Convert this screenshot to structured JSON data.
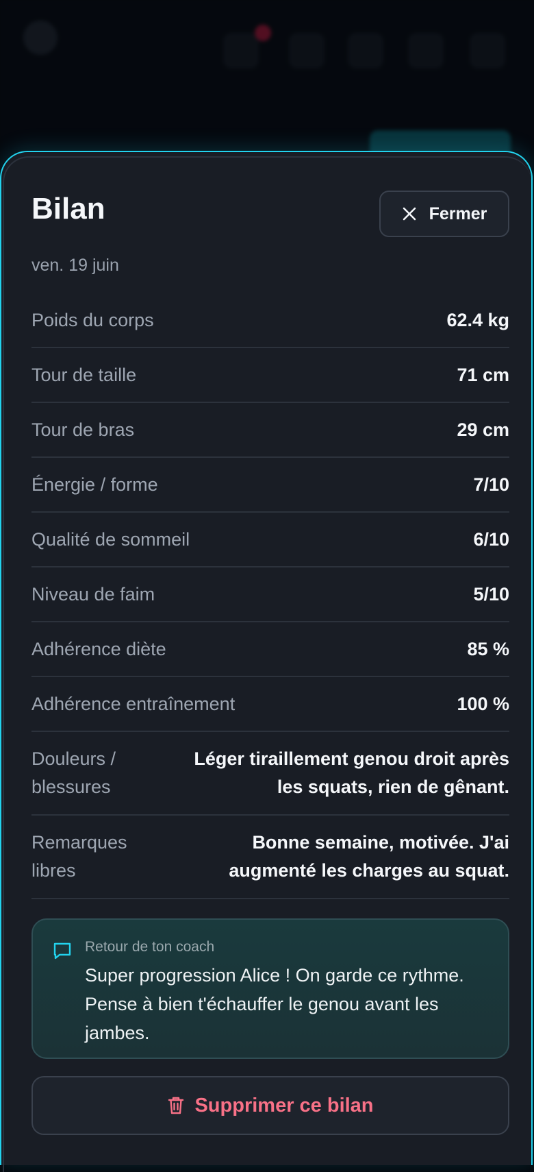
{
  "colors": {
    "sheet_bg": "#191d25",
    "accent_outline": "#22d3ee",
    "text_primary": "#f5f7fa",
    "text_muted": "#9ea6b2",
    "coach_bg": "#1a3a3d",
    "danger": "#f87187"
  },
  "sheet": {
    "title": "Bilan",
    "close_label": "Fermer",
    "close_icon": "close-icon",
    "date": "ven. 19 juin"
  },
  "metrics": [
    {
      "label": "Poids du corps",
      "value": "62.4 kg"
    },
    {
      "label": "Tour de taille",
      "value": "71 cm"
    },
    {
      "label": "Tour de bras",
      "value": "29 cm"
    },
    {
      "label": "Énergie / forme",
      "value": "7/10"
    },
    {
      "label": "Qualité de sommeil",
      "value": "6/10"
    },
    {
      "label": "Niveau de faim",
      "value": "5/10"
    },
    {
      "label": "Adhérence diète",
      "value": "85 %"
    },
    {
      "label": "Adhérence entraînement",
      "value": "100 %"
    },
    {
      "label": "Douleurs / blessures",
      "value": "Léger tiraillement genou droit après les squats, rien de gênant."
    },
    {
      "label": "Remarques libres",
      "value": "Bonne semaine, motivée. J'ai augmenté les charges au squat."
    }
  ],
  "coach": {
    "icon": "chat-bubble-icon",
    "label": "Retour de ton coach",
    "message": "Super progression Alice ! On garde ce rythme. Pense à bien t'échauffer le genou avant les jambes."
  },
  "delete": {
    "label": "Supprimer ce bilan",
    "icon": "trash-icon"
  }
}
